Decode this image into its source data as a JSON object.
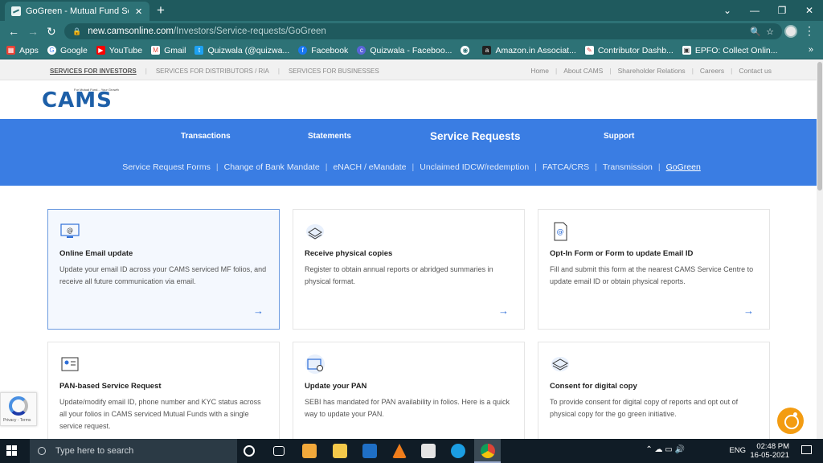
{
  "browser": {
    "tab_title": "GoGreen - Mutual Fund Service R",
    "tab_close": "✕",
    "new_tab": "+",
    "url_host": "new.camsonline.com",
    "url_path": "/Investors/Service-requests/GoGreen",
    "window_controls": [
      "⌄",
      "—",
      "❐",
      "✕"
    ],
    "bookmarks": [
      {
        "label": "Apps",
        "color": "#e94235"
      },
      {
        "label": "Google",
        "color": "#4285f4"
      },
      {
        "label": "YouTube",
        "color": "#ff0000"
      },
      {
        "label": "Gmail",
        "color": "#ea4335"
      },
      {
        "label": "Quizwala (@quizwa...",
        "color": "#1da1f2"
      },
      {
        "label": "Facebook",
        "color": "#1877f2"
      },
      {
        "label": "Quizwala - Faceboo...",
        "color": "#5a64d8"
      },
      {
        "label": "",
        "color": "#ffffff"
      },
      {
        "label": "Amazon.in Associat...",
        "color": "#222222"
      },
      {
        "label": "Contributor Dashb...",
        "color": "#d33"
      },
      {
        "label": "EPFO: Collect Onlin...",
        "color": "#ffffff"
      }
    ],
    "bookmarks_more": "»"
  },
  "site": {
    "top_left": [
      "SERVICES FOR INVESTORS",
      "SERVICES FOR DISTRIBUTORS / RIA",
      "SERVICES FOR BUSINESSES"
    ],
    "top_right": [
      "Home",
      "About CAMS",
      "Shareholder Relations",
      "Careers",
      "Contact us"
    ],
    "logo_tagline": "For Mutual Fund... Your Growth",
    "logo_text": "CAMS",
    "menu": [
      "Transactions",
      "Statements",
      "Service Requests",
      "Support"
    ],
    "submenu": [
      "Service Request Forms",
      "Change of Bank Mandate",
      "eNACH / eMandate",
      "Unclaimed IDCW/redemption",
      "FATCA/CRS",
      "Transmission",
      "GoGreen"
    ],
    "cards": [
      {
        "title": "Online Email update",
        "desc": "Update your email ID across your CAMS serviced MF folios, and receive all future communication via email.",
        "icon": "email-monitor-icon"
      },
      {
        "title": "Receive physical copies",
        "desc": "Register to obtain annual reports or abridged summaries in physical format.",
        "icon": "documents-stack-icon"
      },
      {
        "title": "Opt-In Form or Form to update Email ID",
        "desc": "Fill and submit this form at the nearest CAMS Service Centre to update email ID or obtain physical reports.",
        "icon": "email-form-icon"
      },
      {
        "title": "PAN-based Service Request",
        "desc": "Update/modify email ID, phone number and KYC status across all your folios in CAMS serviced Mutual Funds with a single service request.",
        "icon": "id-card-icon"
      },
      {
        "title": "Update your PAN",
        "desc": "SEBI has mandated for PAN availability in folios. Here is a quick way to update your PAN.",
        "icon": "pan-card-icon"
      },
      {
        "title": "Consent for digital copy",
        "desc": "To provide consent for digital copy of reports and opt out of physical copy for the go green initiative.",
        "icon": "digital-copy-icon"
      }
    ],
    "recaptcha_text": "Privacy - Terms"
  },
  "taskbar": {
    "search_placeholder": "Type here to search",
    "lang": "ENG",
    "time": "02:48 PM",
    "date": "16-05-2021"
  }
}
